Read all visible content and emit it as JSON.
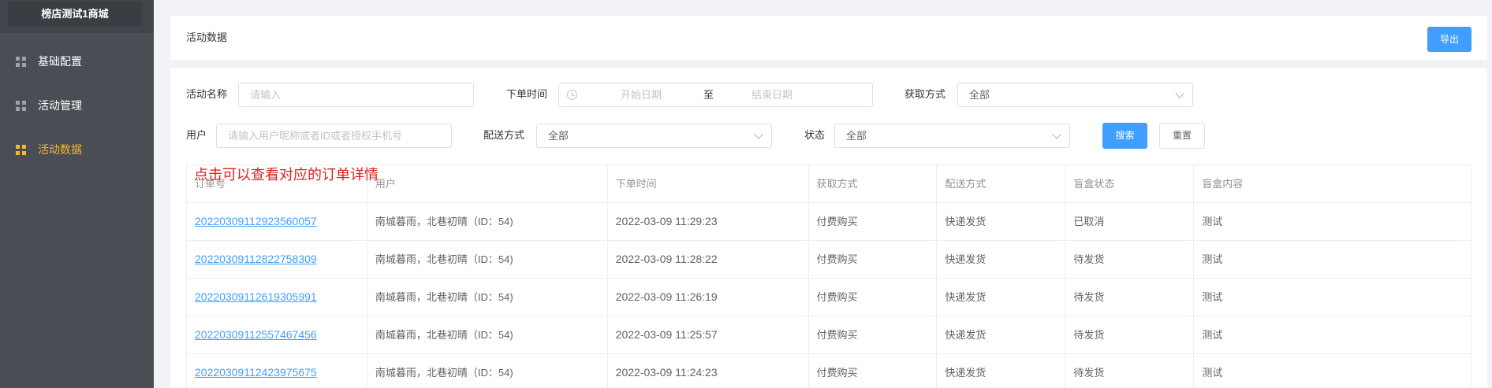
{
  "sidebar": {
    "brand": "榜店测试1商城",
    "items": [
      {
        "label": "基础配置",
        "icon": "grid-icon",
        "active": false
      },
      {
        "label": "活动管理",
        "icon": "grid-icon",
        "active": false
      },
      {
        "label": "活动数据",
        "icon": "grid-icon",
        "active": true
      }
    ]
  },
  "header": {
    "title": "活动数据",
    "export_label": "导出"
  },
  "filters": {
    "activity_name_label": "活动名称",
    "activity_name_placeholder": "请输入",
    "order_time_label": "下单时间",
    "start_date_placeholder": "开始日期",
    "date_separator": "至",
    "end_date_placeholder": "结束日期",
    "acquire_method_label": "获取方式",
    "acquire_method_value": "全部",
    "user_label": "用户",
    "user_placeholder": "请输入用户昵称或者ID或者授权手机号",
    "delivery_method_label": "配送方式",
    "delivery_method_value": "全部",
    "status_label": "状态",
    "status_value": "全部",
    "search_label": "搜索",
    "reset_label": "重置"
  },
  "annotation": "点击可以查看对应的订单详情",
  "table": {
    "columns": [
      "订单号",
      "用户",
      "下单时间",
      "获取方式",
      "配送方式",
      "盲盒状态",
      "盲盒内容"
    ],
    "rows": [
      [
        "20220309112923560057",
        "南城暮雨，北巷初晴（ID：54)",
        "2022-03-09 11:29:23",
        "付费购买",
        "快递发货",
        "已取消",
        "测试"
      ],
      [
        "20220309112822758309",
        "南城暮雨，北巷初晴（ID：54)",
        "2022-03-09 11:28:22",
        "付费购买",
        "快递发货",
        "待发货",
        "测试"
      ],
      [
        "20220309112619305991",
        "南城暮雨，北巷初晴（ID：54)",
        "2022-03-09 11:26:19",
        "付费购买",
        "快递发货",
        "待发货",
        "测试"
      ],
      [
        "20220309112557467456",
        "南城暮雨，北巷初晴（ID：54)",
        "2022-03-09 11:25:57",
        "付费购买",
        "快递发货",
        "待发货",
        "测试"
      ],
      [
        "20220309112423975675",
        "南城暮雨，北巷初晴（ID：54)",
        "2022-03-09 11:24:23",
        "付费购买",
        "快递发货",
        "待发货",
        "测试"
      ]
    ]
  },
  "colors": {
    "primary": "#409eff",
    "sidebar_bg": "#4a4e54",
    "active": "#f5b731",
    "annotation": "#e02020"
  }
}
